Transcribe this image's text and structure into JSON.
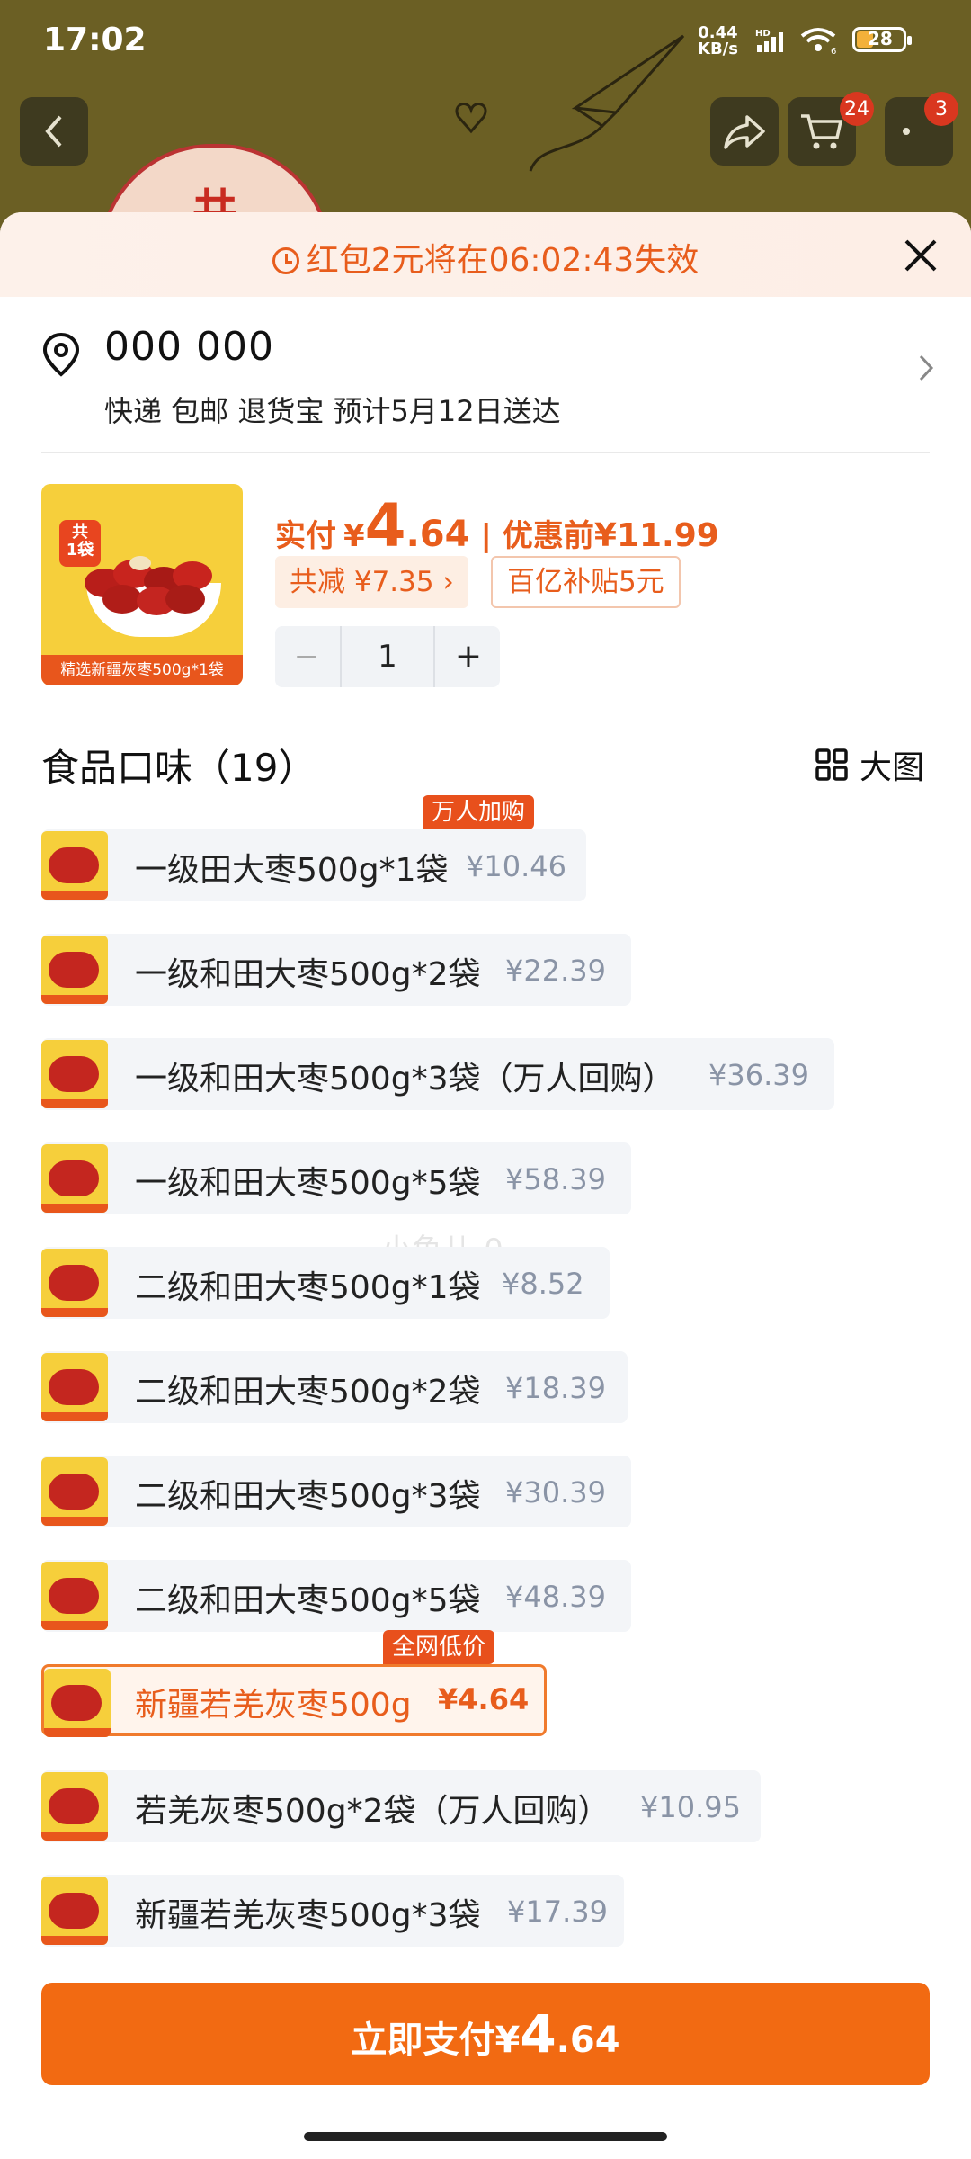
{
  "status_bar": {
    "time": "17:02",
    "net_speed_value": "0.44",
    "net_speed_unit": "KB/s",
    "net_type": "HD",
    "wifi_label": "6",
    "battery_level": "28"
  },
  "top_nav": {
    "cart_badge": "24",
    "more_badge": "3",
    "avatar_char": "共"
  },
  "promo": {
    "text": "红包2元将在06:02:43失效"
  },
  "address": {
    "name": "000 000",
    "info": "快递 包邮 退货宝 预计5月12日送达"
  },
  "product": {
    "image_tag_line1": "共",
    "image_tag_line2": "1袋",
    "image_caption": "精选新疆灰枣500g*1袋",
    "pay_label": "实付",
    "currency": "¥",
    "price_int": "4",
    "price_dec": ".64",
    "before_label": "优惠前",
    "before_price": "¥11.99",
    "saving_chip": "共减 ¥7.35 ›",
    "subsidy_chip": "百亿补贴5元",
    "quantity": "1",
    "minus": "−",
    "plus": "+"
  },
  "section": {
    "title": "食品口味（19）",
    "view_toggle": "大图"
  },
  "options": [
    {
      "name": "一级田大枣500g*1袋",
      "price": "¥10.46",
      "tag": "万人加购"
    },
    {
      "name": "一级和田大枣500g*2袋",
      "price": "¥22.39"
    },
    {
      "name": "一级和田大枣500g*3袋（万人回购）",
      "price": "¥36.39"
    },
    {
      "name": "一级和田大枣500g*5袋",
      "price": "¥58.39"
    },
    {
      "name": "二级和田大枣500g*1袋",
      "price": "¥8.52"
    },
    {
      "name": "二级和田大枣500g*2袋",
      "price": "¥18.39"
    },
    {
      "name": "二级和田大枣500g*3袋",
      "price": "¥30.39"
    },
    {
      "name": "二级和田大枣500g*5袋",
      "price": "¥48.39"
    },
    {
      "name": "新疆若羌灰枣500g",
      "price": "¥4.64",
      "tag": "全网低价",
      "selected": true
    },
    {
      "name": "若羌灰枣500g*2袋（万人回购）",
      "price": "¥10.95"
    },
    {
      "name": "新疆若羌灰枣500g*3袋",
      "price": "¥17.39"
    }
  ],
  "watermark": "小鱼儿-0",
  "pay_button": {
    "label": "立即支付",
    "currency": "¥",
    "price_int": "4",
    "price_dec": ".64"
  },
  "colors": {
    "accent": "#f26a12",
    "price_orange": "#e85d1c",
    "chip_bg": "#f3f5f8"
  }
}
